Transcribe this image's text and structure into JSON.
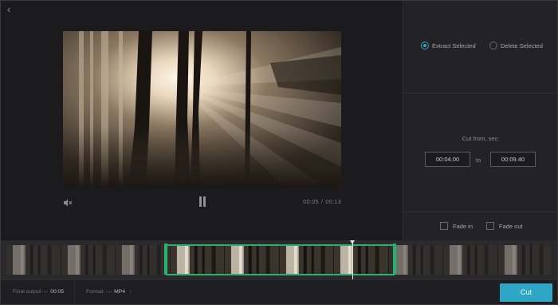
{
  "player": {
    "current_time": "00:05",
    "separator": "/",
    "duration": "00:13",
    "back_icon": "chevron-left-icon",
    "mute_icon": "speaker-muted-icon",
    "pause_icon": "pause-icon"
  },
  "panel": {
    "mode_options": [
      {
        "label": "Extract Selected",
        "selected": true
      },
      {
        "label": "Delete Selected",
        "selected": false
      }
    ],
    "cut_from_label": "Cut from, sec:",
    "from_value": "00:04.00",
    "to_label": "to",
    "to_value": "00:09.40",
    "fade_in_label": "Fade in",
    "fade_in_checked": false,
    "fade_out_label": "Fade out",
    "fade_out_checked": false
  },
  "footer": {
    "final_output_label": "Final output —",
    "final_output_value": "00:05",
    "format_label": "Format: —",
    "format_value": "MP4",
    "format_icon": "updown-arrow-icon",
    "cut_button": "Cut"
  },
  "colors": {
    "accent": "#2fa6c6",
    "selection": "#27b36f",
    "background": "#1e1e20"
  }
}
